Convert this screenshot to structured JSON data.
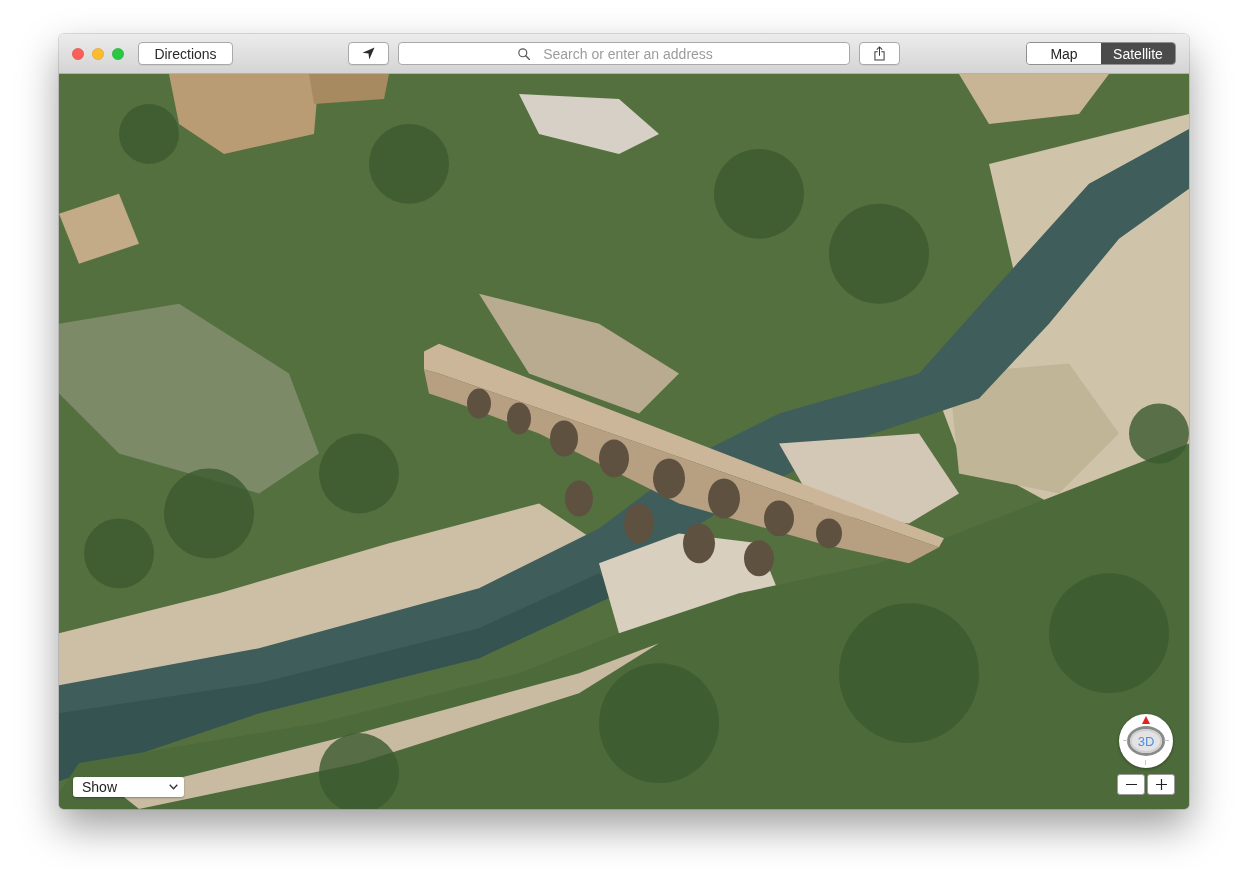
{
  "toolbar": {
    "directions_button": "Directions",
    "search": {
      "placeholder": "Search or enter an address"
    },
    "map_modes": [
      {
        "label": "Map",
        "selected": false
      },
      {
        "label": "Satellite",
        "selected": true
      }
    ]
  },
  "map": {
    "show_menu": {
      "value": "Show"
    },
    "compass": {
      "label": "3D"
    }
  }
}
